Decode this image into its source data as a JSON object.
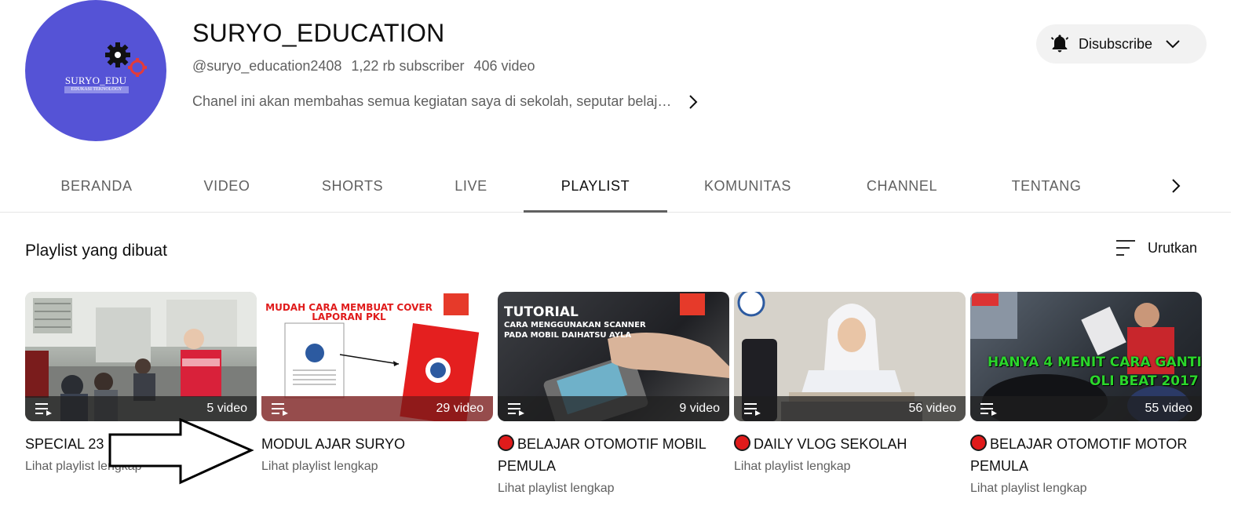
{
  "channel": {
    "logo_text": "SURYO_EDU",
    "logo_subtext": "EDUKASI TEKNOLOGY",
    "name": "SURYO_EDUCATION",
    "handle": "@suryo_education2408",
    "subscribers": "1,22 rb subscriber",
    "videos": "406 video",
    "description": "Chanel ini akan membahas semua kegiatan saya di sekolah, seputar belaj…"
  },
  "subscribe_button": {
    "label": "Disubscribe",
    "icon": "bell-icon"
  },
  "tabs": [
    {
      "label": "BERANDA",
      "active": false
    },
    {
      "label": "VIDEO",
      "active": false
    },
    {
      "label": "SHORTS",
      "active": false
    },
    {
      "label": "LIVE",
      "active": false
    },
    {
      "label": "PLAYLIST",
      "active": true
    },
    {
      "label": "KOMUNITAS",
      "active": false
    },
    {
      "label": "CHANNEL",
      "active": false
    },
    {
      "label": "TENTANG",
      "active": false
    }
  ],
  "section": {
    "title": "Playlist yang dibuat",
    "sort_label": "Urutkan"
  },
  "playlists": [
    {
      "title": "SPECIAL 23",
      "count": "5 video",
      "link": "Lihat playlist lengkap",
      "live_dot": false
    },
    {
      "title": "MODUL AJAR SURYO",
      "count": "29 video",
      "link": "Lihat playlist lengkap",
      "live_dot": false,
      "thumb_text": "MUDAH CARA MEMBUAT COVER LAPORAN PKL"
    },
    {
      "title": "BELAJAR OTOMOTIF MOBIL PEMULA",
      "count": "9 video",
      "link": "Lihat playlist lengkap",
      "live_dot": true,
      "thumb_text_1": "TUTORIAL",
      "thumb_text_2": "CARA MENGGUNAKAN SCANNER",
      "thumb_text_3": "PADA MOBIL DAIHATSU AYLA"
    },
    {
      "title": "DAILY VLOG SEKOLAH",
      "count": "56 video",
      "link": "Lihat playlist lengkap",
      "live_dot": true
    },
    {
      "title": "BELAJAR OTOMOTIF MOTOR PEMULA",
      "count": "55 video",
      "link": "Lihat playlist lengkap",
      "live_dot": true,
      "thumb_text_1": "HANYA 4 MENIT CARA GANTI",
      "thumb_text_2": "OLI BEAT 2017"
    }
  ],
  "colors": {
    "accent_dot": "#e01b1b",
    "avatar_bg": "#5553d6",
    "tab_underline": "#606060"
  }
}
